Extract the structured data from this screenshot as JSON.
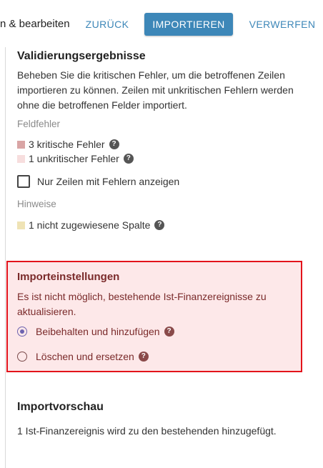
{
  "header": {
    "title": "n & bearbeiten",
    "back_label": "ZURÜCK",
    "import_label": "IMPORTIEREN",
    "discard_label": "VERWERFEN",
    "accent_color": "#3d87b8"
  },
  "validation": {
    "title": "Validierungsergebnisse",
    "description": "Beheben Sie die kritischen Fehler, um die betroffenen Zeilen importieren zu können. Zeilen mit unkritischen Fehlern werden ohne die betroffenen Felder importiert.",
    "field_errors_label": "Feldfehler",
    "critical_label": "3 kritische Fehler",
    "critical_color": "#d9a5a5",
    "noncritical_label": "1 unkritischer Fehler",
    "noncritical_color": "#f7dede",
    "only_errors_checkbox": "Nur Zeilen mit Fehlern anzeigen",
    "hints_label": "Hinweise",
    "unassigned_label": "1 nicht zugewiesene Spalte",
    "unassigned_color": "#efe3b5"
  },
  "settings": {
    "title": "Importeinstellungen",
    "description": "Es ist nicht möglich, bestehende Ist-Finanzereignisse zu aktualisieren.",
    "option_keep": "Beibehalten und hinzufügen",
    "option_replace": "Löschen und ersetzen",
    "selected": "option_keep",
    "highlight_color": "#e3131b"
  },
  "preview": {
    "title": "Importvorschau",
    "text": "1 Ist-Finanzereignis wird zu den bestehenden hinzugefügt."
  }
}
